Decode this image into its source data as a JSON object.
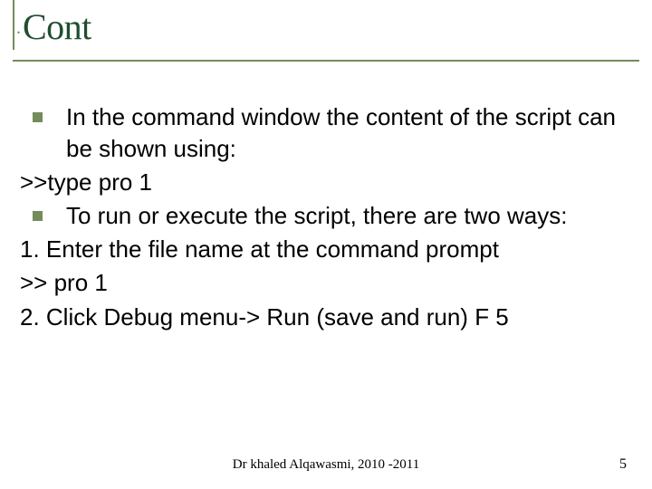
{
  "title": "Cont",
  "bullets": [
    "In the command window the content of the script can be shown using:",
    "To run or execute the script, there are two ways:"
  ],
  "lines": {
    "cmd1": ">>type pro 1",
    "num1": "1. Enter the file name at the command prompt",
    "cmd2": ">> pro 1",
    "num2": "2. Click Debug menu-> Run (save and run) F 5"
  },
  "footer": {
    "center": "Dr khaled Alqawasmi, 2010 -2011",
    "page": "5"
  }
}
